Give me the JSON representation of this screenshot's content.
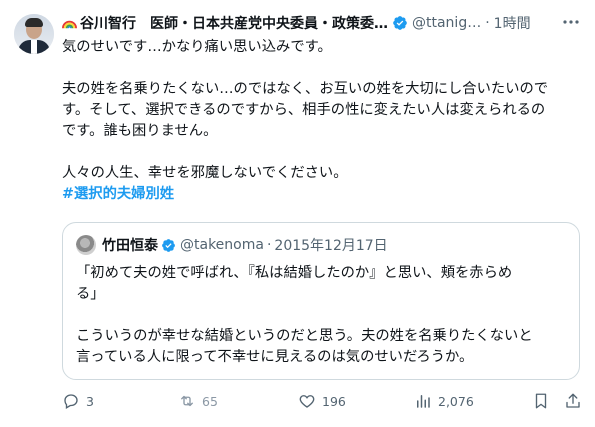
{
  "author": {
    "emoji_icon": "rainbow-emoji",
    "display_name": "谷川智行　医師・日本共産党中央委員・政策委…",
    "handle": "@ttanig…",
    "separator": "·",
    "time": "1時間"
  },
  "post": {
    "line1": "気のせいです…かなり痛い思い込みです。",
    "para2_l1": "夫の姓を名乗りたくない…のではなく、お互いの姓を大切にし合いたいので",
    "para2_l2": "す。そして、選択できるのですから、相手の性に変えたい人は変えられるの",
    "para2_l3": "です。誰も困りません。",
    "para3": "人々の人生、幸せを邪魔しないでください。",
    "hashtag": "#選択的夫婦別姓"
  },
  "quote": {
    "name": "竹田恒泰",
    "handle": "@takenoma",
    "separator": "·",
    "date": "2015年12月17日",
    "p1_l1": "「初めて夫の姓で呼ばれ、『私は結婚したのか』と思い、頬を赤らめ",
    "p1_l2": "る」",
    "p2_l1": "こういうのが幸せな結婚というのだと思う。夫の姓を名乗りたくないと",
    "p2_l2": "言っている人に限って不幸せに見えるのは気のせいだろうか。"
  },
  "actions": {
    "replies": "3",
    "reposts": "65",
    "likes": "196",
    "views": "2,076"
  },
  "colors": {
    "accent": "#1d9bf0",
    "text": "#0f1419",
    "muted": "#536471",
    "border": "#cfd9de"
  },
  "icons": [
    "avatar",
    "rainbow-emoji",
    "verified-badge-icon",
    "more-icon",
    "reply-icon",
    "repost-icon",
    "like-icon",
    "views-icon",
    "bookmark-icon",
    "share-icon"
  ]
}
